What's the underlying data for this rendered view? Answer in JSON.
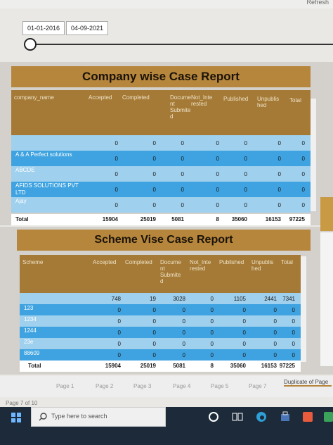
{
  "window": {
    "refresh_label": "Refresh"
  },
  "filters": {
    "start_date": "01-01-2016",
    "end_date": "04-09-2021"
  },
  "company_report": {
    "title": "Company wise Case Report",
    "columns": [
      "company_name",
      "Accepted",
      "Completed",
      "Docume nt Submite d",
      "Not_Inte rested",
      "Published",
      "Unpublis hed",
      "Total"
    ],
    "rows": [
      {
        "name": "",
        "values": [
          "0",
          "0",
          "0",
          "0",
          "0",
          "0",
          "0"
        ]
      },
      {
        "name": "A & A Perfect solutions",
        "values": [
          "0",
          "0",
          "0",
          "0",
          "0",
          "0",
          "0"
        ]
      },
      {
        "name": "ABCDE",
        "values": [
          "0",
          "0",
          "0",
          "0",
          "0",
          "0",
          "0"
        ]
      },
      {
        "name": "AFIDS SOLUTIONS PVT LTD",
        "values": [
          "0",
          "0",
          "0",
          "0",
          "0",
          "0",
          "0"
        ]
      },
      {
        "name": "Ajay",
        "values": [
          "0",
          "0",
          "0",
          "0",
          "0",
          "0",
          "0"
        ]
      }
    ],
    "total": {
      "label": "Total",
      "values": [
        "15904",
        "25019",
        "5081",
        "8",
        "35060",
        "16153",
        "97225"
      ]
    }
  },
  "scheme_report": {
    "title": "Scheme Vise Case Report",
    "columns": [
      "Scheme",
      "Accepted",
      "Completed",
      "Docume nt Submite d",
      "Not_Inte rested",
      "Published",
      "Unpublis hed",
      "Total"
    ],
    "rows": [
      {
        "name": "",
        "values": [
          "748",
          "19",
          "3028",
          "0",
          "1105",
          "2441",
          "7341"
        ]
      },
      {
        "name": "123",
        "values": [
          "0",
          "0",
          "0",
          "0",
          "0",
          "0",
          "0"
        ]
      },
      {
        "name": "1234",
        "values": [
          "0",
          "0",
          "0",
          "0",
          "0",
          "0",
          "0"
        ]
      },
      {
        "name": "1244",
        "values": [
          "0",
          "0",
          "0",
          "0",
          "0",
          "0",
          "0"
        ]
      },
      {
        "name": "23e",
        "values": [
          "0",
          "0",
          "0",
          "0",
          "0",
          "0",
          "0"
        ]
      },
      {
        "name": "88609",
        "values": [
          "0",
          "0",
          "0",
          "0",
          "0",
          "0",
          "0"
        ]
      }
    ],
    "total": {
      "label": "Total",
      "values": [
        "15904",
        "25019",
        "5081",
        "8",
        "35060",
        "16153",
        "97225"
      ]
    }
  },
  "pages": {
    "tabs": [
      "Page 1",
      "Page 2",
      "Page 3",
      "Page 4",
      "Page 5",
      "Page 7",
      "Duplicate of Page"
    ],
    "status": "Page 7 of 10"
  },
  "taskbar": {
    "search_placeholder": "Type here to search"
  },
  "colors": {
    "header_gold": "#b6863c",
    "row_light_blue": "#9fd0ee",
    "row_blue": "#3ea3e0"
  }
}
